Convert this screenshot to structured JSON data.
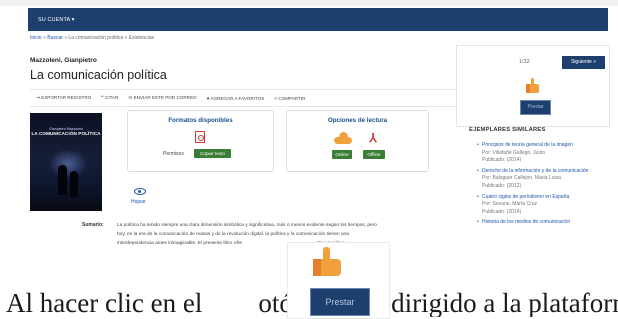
{
  "nav": {
    "menu_label": "SU CUENTA ▾"
  },
  "breadcrumb": {
    "home": "Inicio",
    "sep": " » ",
    "search": "Buscar",
    "current": "La comunicación política",
    "last": "Existencias"
  },
  "record": {
    "author": "Mazzoleni, Gianpietro",
    "title": "La comunicación política"
  },
  "toolbar": {
    "export": "⇥ EXPORTAR REGISTRO",
    "cite": "❞ CITAR",
    "email": "✉ ENVIAR ESTE POR CORREO",
    "favorites": "♥ AGREGAR A FAVORITOS",
    "share": "< COMPARTIR"
  },
  "cover": {
    "author": "Gianpietro Mazzoleni",
    "title": "LA COMUNICACIÓN POLÍTICA"
  },
  "formats": {
    "heading": "Formatos disponibles",
    "permiso_label": "Permisos",
    "copy_button": "Copiar texto"
  },
  "reading": {
    "heading": "Opciones de lectura",
    "online": "Online",
    "offline": "Offline"
  },
  "hojear": "Hojear",
  "sumario": {
    "label": "Sumario:",
    "line1": "La política ha tenido siempre una clara dimensión simbólica y significativa, más o menos evidente según los tiempos, pero",
    "line2": "hoy, en la era de la comunicación de masas y de la revolución digital, la política y la comunicación tienen una",
    "line3": "interdependencia antes inimaginable. El presente libro ofre",
    "line3_end": "nte y ayuda a"
  },
  "pager": {
    "position": "1/32",
    "next": "Siguiente »"
  },
  "loan": {
    "button": "Prestar"
  },
  "similar": {
    "heading": "EJEMPLARES SIMILARES",
    "items": [
      {
        "title": "Principios de teoría general de la imagen",
        "by": "Por: Villafañe Gallego, Justo",
        "pub": "Publicado: (2014)"
      },
      {
        "title": "Derecho de la información y de la comunicación",
        "by": "Por: Balaguer Callejón, María Luisa",
        "pub": "Publicado: (2012)"
      },
      {
        "title": "Cuatro siglos de periodismo en España",
        "by": "Por: Sevane, María Cruz",
        "pub": "Publicado: (2014)"
      },
      {
        "title": "Historia de los medios de comunicación",
        "by": "",
        "pub": ""
      }
    ]
  },
  "overlay": {
    "button": "Prestar"
  },
  "bottom_text": {
    "left": "Al hacer clic en el",
    "right": "otón, será redirigido a la plataforma"
  },
  "colors": {
    "nav": "#1c3f6e",
    "accent_green": "#3a7d35",
    "thumb_orange": "#f0a13b",
    "pdf_red": "#d3342c",
    "link": "#1a57a8"
  }
}
